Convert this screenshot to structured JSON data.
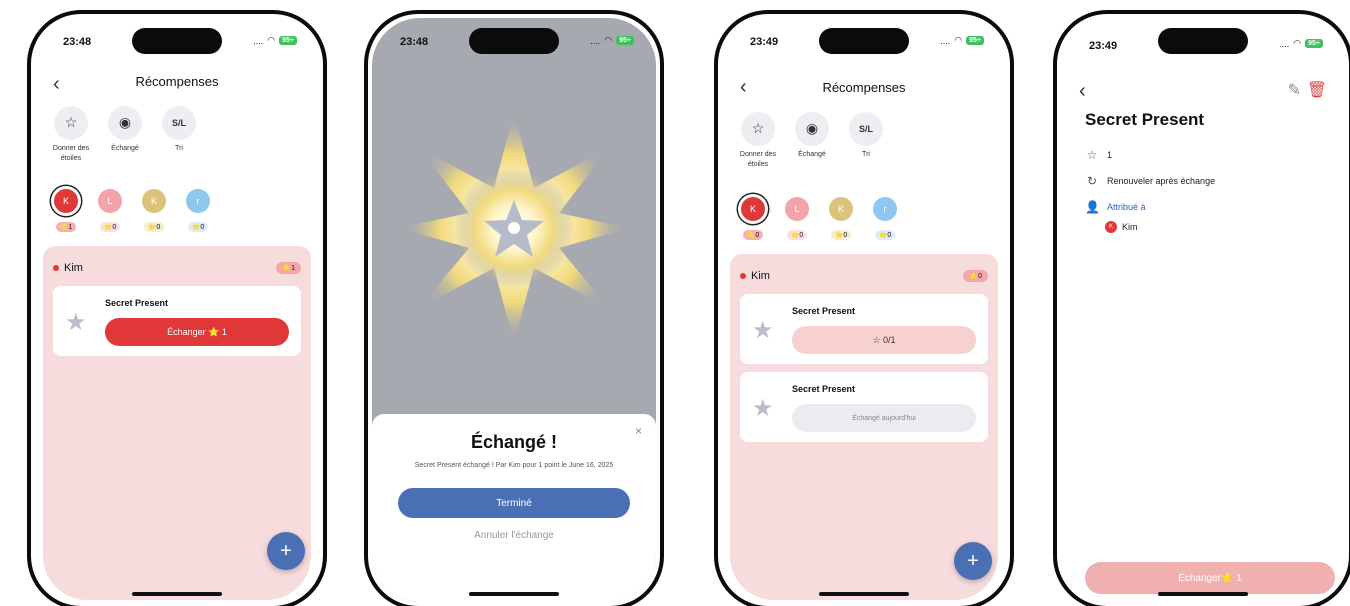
{
  "screen1": {
    "time": "23:48",
    "battery": "95+",
    "title": "Récompenses",
    "actions": [
      {
        "icon": "star-outline-icon",
        "label": "Donner des étoiles"
      },
      {
        "icon": "eye-icon",
        "label": "Échangé"
      },
      {
        "icon": "sort-icon",
        "glyph": "S/L",
        "label": "Tri"
      }
    ],
    "kids": [
      {
        "initial": "K",
        "color": "#e03838",
        "badge_bg": "#f5b1b1",
        "stars": "1"
      },
      {
        "initial": "L",
        "color": "#f4a3ab",
        "badge_bg": "#fbe0e2",
        "stars": "0"
      },
      {
        "initial": "K",
        "color": "#dcc37a",
        "badge_bg": "#f6ecd0",
        "stars": "0"
      },
      {
        "initial": "r",
        "color": "#8fc8ee",
        "badge_bg": "#dcecf8",
        "stars": "0"
      }
    ],
    "panel_name": "Kim",
    "panel_stars": "1",
    "reward_name": "Secret Present",
    "exchange_label": "Échanger ⭐ 1",
    "fab": "+"
  },
  "screen2": {
    "time": "23:48",
    "battery": "95+",
    "dialog_title": "Échangé !",
    "dialog_desc": "Secret Present échangé ! Par Kim pour 1 point le June 16, 2025",
    "done_label": "Terminé",
    "cancel_label": "Annuler l'échange",
    "close": "×"
  },
  "screen3": {
    "time": "23:49",
    "battery": "95+",
    "title": "Récompenses",
    "actions": [
      {
        "icon": "star-outline-icon",
        "label": "Donner des étoiles"
      },
      {
        "icon": "eye-icon",
        "label": "Échangé"
      },
      {
        "icon": "sort-icon",
        "glyph": "S/L",
        "label": "Tri"
      }
    ],
    "kids": [
      {
        "initial": "K",
        "color": "#e03838",
        "badge_bg": "#f5b1b1",
        "stars": "0"
      },
      {
        "initial": "L",
        "color": "#f4a3ab",
        "badge_bg": "#fbe0e2",
        "stars": "0"
      },
      {
        "initial": "K",
        "color": "#dcc37a",
        "badge_bg": "#f6ecd0",
        "stars": "0"
      },
      {
        "initial": "r",
        "color": "#8fc8ee",
        "badge_bg": "#dcecf8",
        "stars": "0"
      }
    ],
    "panel_name": "Kim",
    "panel_stars": "0",
    "rewards": [
      {
        "name": "Secret Present",
        "button": "0/1"
      },
      {
        "name": "Secret Present",
        "button": "Échangé aujourd'hui"
      }
    ],
    "fab": "+"
  },
  "screen4": {
    "time": "23:49",
    "battery": "95+",
    "title": "Secret Present",
    "stars": "1",
    "renew": "Renouveler après échange",
    "assigned_label": "Attribué à",
    "assigned_initial": "K",
    "assigned_name": "Kim",
    "exchange_label": "Échanger⭐ 1"
  },
  "colors": {
    "accent_red": "#e03838",
    "accent_blue": "#4a6fb5",
    "panel_pink": "#f7dcdd"
  }
}
